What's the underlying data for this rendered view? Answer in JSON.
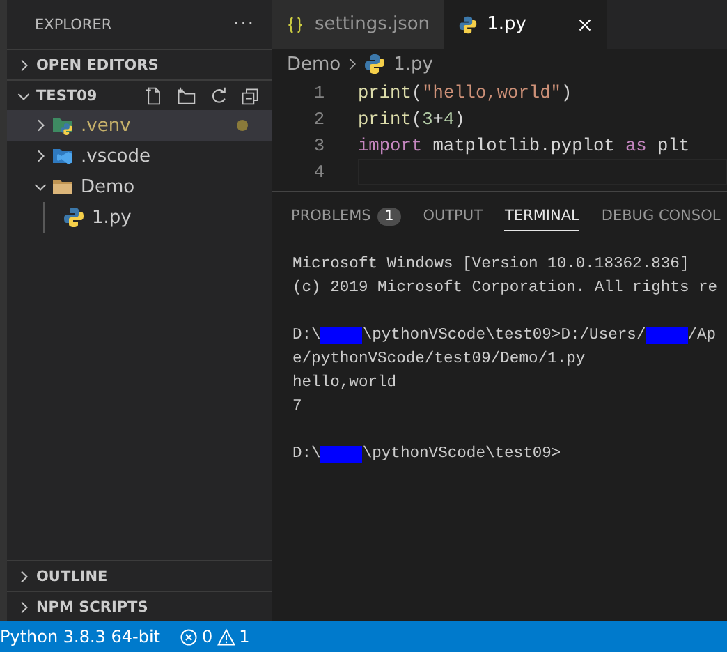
{
  "sidebar": {
    "title": "EXPLORER",
    "more": "···",
    "sections": [
      {
        "label": "OPEN EDITORS",
        "expanded": false
      },
      {
        "label": "TEST09",
        "expanded": true,
        "tree": [
          {
            "label": ".venv",
            "kind": "folder-python",
            "expanded": false,
            "selected": true,
            "modified": true
          },
          {
            "label": ".vscode",
            "kind": "folder-vscode",
            "expanded": false,
            "selected": false,
            "modified": false
          },
          {
            "label": "Demo",
            "kind": "folder",
            "expanded": true,
            "selected": false,
            "modified": false,
            "children": [
              {
                "label": "1.py",
                "kind": "python",
                "selected": false,
                "modified": false
              }
            ]
          }
        ]
      }
    ],
    "bottom_sections": [
      {
        "label": "OUTLINE",
        "expanded": false
      },
      {
        "label": "NPM SCRIPTS",
        "expanded": false
      }
    ]
  },
  "tabs": [
    {
      "label": "settings.json",
      "kind": "json",
      "selected": false
    },
    {
      "label": "1.py",
      "kind": "python",
      "selected": true
    }
  ],
  "breadcrumb": [
    {
      "label": "Demo"
    },
    {
      "label": "1.py",
      "kind": "python"
    }
  ],
  "code": [
    {
      "number": "1",
      "current": false,
      "tokens": [
        {
          "kind": "func",
          "text": "print"
        },
        {
          "kind": "punct",
          "text": "("
        },
        {
          "kind": "string",
          "text": "\"hello,world\""
        },
        {
          "kind": "punct",
          "text": ")"
        }
      ]
    },
    {
      "number": "2",
      "current": false,
      "tokens": [
        {
          "kind": "func",
          "text": "print"
        },
        {
          "kind": "punct",
          "text": "("
        },
        {
          "kind": "number",
          "text": "3"
        },
        {
          "kind": "punct",
          "text": "+"
        },
        {
          "kind": "number",
          "text": "4"
        },
        {
          "kind": "punct",
          "text": ")"
        }
      ]
    },
    {
      "number": "3",
      "current": false,
      "tokens": [
        {
          "kind": "keyword",
          "text": "import"
        },
        {
          "kind": "plain",
          "text": " matplotlib.pyplot "
        },
        {
          "kind": "keyword",
          "text": "as"
        },
        {
          "kind": "plain",
          "text": " plt"
        }
      ]
    },
    {
      "number": "4",
      "current": true
    }
  ],
  "panel": {
    "tabs": [
      {
        "label": "PROBLEMS",
        "badge": "1",
        "selected": false
      },
      {
        "label": "OUTPUT",
        "selected": false
      },
      {
        "label": "TERMINAL",
        "selected": true
      },
      {
        "label": "DEBUG CONSOL",
        "selected": false
      }
    ],
    "terminal": [
      {
        "kind": "text",
        "segments": [
          {
            "kind": "text",
            "text": "Microsoft Windows [Version 10.0.18362.836]"
          }
        ]
      },
      {
        "kind": "text",
        "segments": [
          {
            "kind": "text",
            "text": "(c) 2019 Microsoft Corporation. All rights re"
          }
        ]
      },
      {
        "kind": "blank"
      },
      {
        "kind": "text",
        "segments": [
          {
            "kind": "text",
            "text": "D:\\"
          },
          {
            "kind": "redacted"
          },
          {
            "kind": "text",
            "text": "\\pythonVScode\\test09>D:/Users/"
          },
          {
            "kind": "redacted"
          },
          {
            "kind": "text",
            "text": "/Ap"
          }
        ]
      },
      {
        "kind": "text",
        "segments": [
          {
            "kind": "text",
            "text": "e/pythonVScode/test09/Demo/1.py"
          }
        ]
      },
      {
        "kind": "text",
        "segments": [
          {
            "kind": "text",
            "text": "hello,world"
          }
        ]
      },
      {
        "kind": "text",
        "segments": [
          {
            "kind": "text",
            "text": "7"
          }
        ]
      },
      {
        "kind": "blank"
      },
      {
        "kind": "text",
        "segments": [
          {
            "kind": "text",
            "text": "D:\\"
          },
          {
            "kind": "redacted"
          },
          {
            "kind": "text",
            "text": "\\pythonVScode\\test09>"
          }
        ]
      }
    ]
  },
  "status_bar": {
    "interpreter": "Python 3.8.3 64-bit",
    "errors": "0",
    "warnings": "1"
  }
}
